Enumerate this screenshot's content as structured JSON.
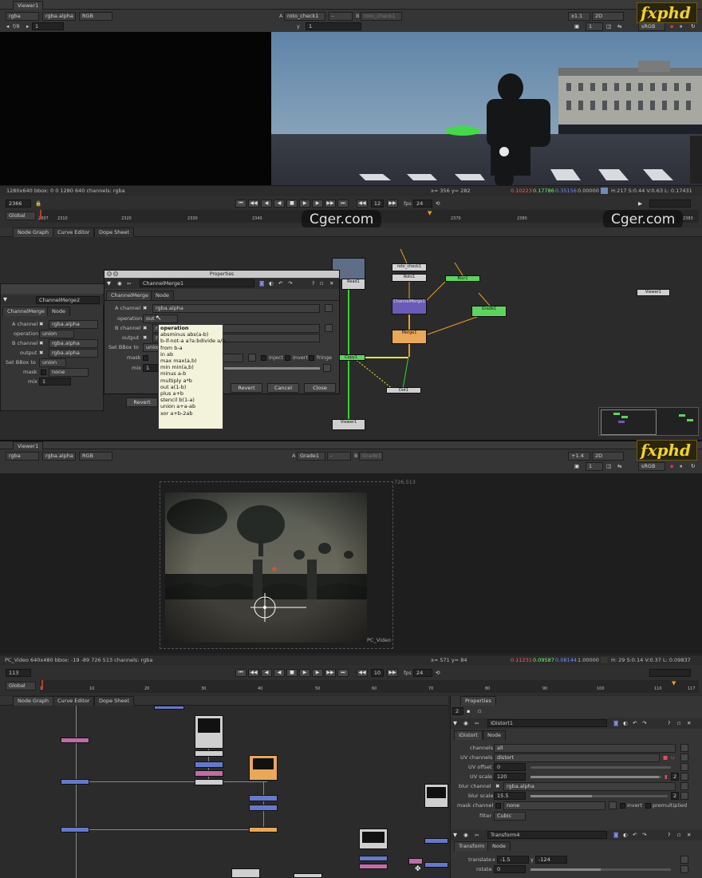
{
  "top_viewer": {
    "tab": "Viewer1",
    "channels": "rgba",
    "alpha_channel": "rgba.alpha",
    "colorspace_mode": "RGB",
    "a_label": "A",
    "a_input": "roto_check1",
    "a_op": "-",
    "b_label": "B",
    "b_input": "roto_check1",
    "zoom": "x1.1",
    "view": "2D",
    "lut": "sRGB",
    "fstop": "f/8",
    "frame_field": "1",
    "y_label": "y",
    "y_value": "1",
    "proxy_value": "1",
    "info_left": "1280x640 bbox: 0 0 1280 640 channels: rgba",
    "coords": "x= 356 y= 282",
    "r": "0.10223",
    "g": "0.17786",
    "b": "0.35156",
    "a": "0.00000",
    "hsvl": "H:217 S:0.44 V:0.63 L: 0.17431"
  },
  "top_timeline": {
    "current_frame": "2366",
    "frame_display": "12",
    "fps_label": "fps",
    "fps": "24",
    "scope": "Global",
    "start": "2307",
    "end": "2383",
    "ticks": [
      "2310",
      "2320",
      "2330",
      "2340",
      "2370",
      "2380"
    ]
  },
  "watermarks": {
    "cger": "Cger.com",
    "fxphd": "fxphd"
  },
  "node_graph_tabs": [
    "Node Graph",
    "Curve Editor",
    "Dope Sheet"
  ],
  "properties_float": {
    "title": "Properties",
    "node_name": "ChannelMerge1",
    "tabs": [
      "ChannelMerge",
      "Node"
    ],
    "a_channel_label": "A channel",
    "a_channel": "rgba.alpha",
    "operation_label": "operation",
    "operation": "out",
    "b_channel_label": "B channel",
    "b_channel": "rgba.alpha",
    "output_label": "output",
    "output": "rgba.alpha",
    "bbox_label": "Set BBox to",
    "bbox": "union",
    "mask_label": "mask",
    "mask": "none",
    "inject": "inject",
    "invert": "invert",
    "fringe": "fringe",
    "mix_label": "mix",
    "mix": "1",
    "revert": "Revert",
    "cancel": "Cancel",
    "close": "Close"
  },
  "operation_menu": [
    "operation",
    "absminus abs(a-b)",
    "b-if-not-a a?a:b",
    "divide a/b",
    "from b-a",
    "in ab",
    "max max(a,b)",
    "min min(a,b)",
    "minus a-b",
    "multiply a*b",
    "out a(1-b)",
    "plus a+b",
    "stencil b(1-a)",
    "union a+a-ab",
    "xor a+b-2ab"
  ],
  "properties_back": {
    "node_name": "ChannelMerge2",
    "tabs": [
      "ChannelMerge",
      "Node"
    ],
    "a_channel_label": "A channel",
    "a_channel": "rgba.alpha",
    "operation_label": "operation",
    "operation": "union",
    "b_channel_label": "B channel",
    "b_channel": "rgba.alpha",
    "output_label": "output",
    "output": "rgba.alpha",
    "bbox_label": "Set BBox to",
    "bbox": "union",
    "mask_label": "mask",
    "mask": "none",
    "mix_label": "mix",
    "mix": "1",
    "revert": "Revert"
  },
  "top_nodes": {
    "read": "Read1",
    "roto_check": "roto_check1",
    "grade": "Grade1",
    "blur": "Blur1",
    "cmerge": "ChannelMerge1",
    "merge": "Merge1",
    "dot": "Dot1",
    "viewer": "Viewer1",
    "copy": "Copy1",
    "roto": "Roto1"
  },
  "bottom_viewer": {
    "tab": "Viewer1",
    "channels": "rgba",
    "alpha_channel": "rgba.alpha",
    "colorspace_mode": "RGB",
    "a_label": "A",
    "a_input": "Grade1",
    "a_op": "-",
    "b_label": "B",
    "b_input": "Grade1",
    "zoom": "+1.4",
    "view": "2D",
    "lut": "sRGB",
    "bbox_corner": "726,513",
    "source_label": "PC_Video",
    "info_left": "PC_Video 640x480 bbox: -19 -89 726 513 channels: rgba",
    "coords": "x= 571 y= 84",
    "r": "0.11231",
    "g": "0.09587",
    "b": "0.08144",
    "a": "1.00000",
    "hsvl": "H: 29 S:0.14 V:0.37 L: 0.09837"
  },
  "bottom_timeline": {
    "current_frame": "113",
    "frame_display": "10",
    "fps_label": "fps",
    "fps": "24",
    "scope": "Global",
    "start": "1",
    "end": "117",
    "ticks": [
      "10",
      "20",
      "30",
      "40",
      "50",
      "60",
      "70",
      "80",
      "90",
      "100",
      "110"
    ]
  },
  "bottom_node_graph_tabs": [
    "Node Graph",
    "Curve Editor",
    "Dope Sheet"
  ],
  "bottom_properties": {
    "title": "Properties",
    "count": "2",
    "idistort": {
      "name": "IDistort1",
      "tabs": [
        "IDistort",
        "Node"
      ],
      "channels_label": "channels",
      "channels": "all",
      "uv_label": "UV channels",
      "uv": "distort",
      "uv_suffix": "u",
      "uv_offset_label": "UV offset",
      "uv_offset": "0",
      "uv_scale_label": "UV scale",
      "uv_scale": "120",
      "uv_scale_n": "2",
      "blur_ch_label": "blur channel",
      "blur_ch": "rgba.alpha",
      "blur_scale_label": "blur scale",
      "blur_scale": "15.5",
      "blur_scale_n": "2",
      "mask_label": "mask channel",
      "mask": "none",
      "invert": "invert",
      "premult": "premultiplied",
      "filter_label": "filter",
      "filter": "Cubic"
    },
    "transform": {
      "name": "Transform4",
      "tabs": [
        "Transform",
        "Node"
      ],
      "translate_label": "translate",
      "tx_label": "x",
      "tx": "-1.5",
      "ty_label": "y",
      "ty": "-124",
      "rotate_label": "rotate",
      "rotate": "0"
    }
  },
  "colors": {
    "accent_green": "#33d233",
    "node_purple": "#6a5bb8",
    "node_orange": "#e8a85a",
    "node_pink": "#c06ca6",
    "node_blue": "#6679c8",
    "lut_red": "#e05060"
  }
}
